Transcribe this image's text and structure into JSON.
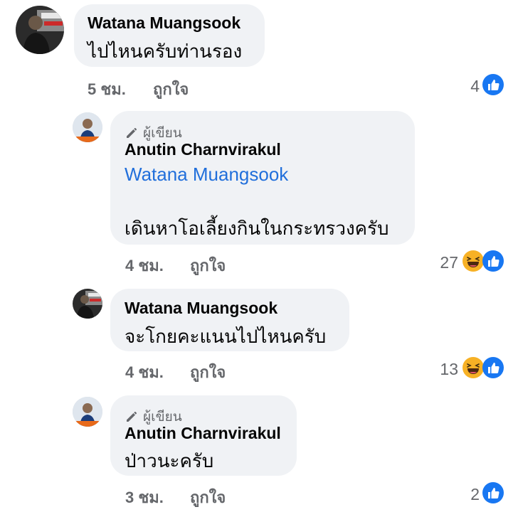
{
  "author_badge_label": "ผู้เขียน",
  "comments": [
    {
      "name": "Watana Muangsook",
      "text": "ไปไหนครับท่านรอง",
      "time": "5 ชม.",
      "like_label": "ถูกใจ",
      "reaction_count": "4",
      "reactions": [
        "like-icon"
      ]
    },
    {
      "author": true,
      "name": "Anutin Charnvirakul",
      "mention": "Watana Muangsook",
      "text": "เดินหาโอเลี้ยงกินในกระทรวงครับ",
      "time": "4 ชม.",
      "like_label": "ถูกใจ",
      "reaction_count": "27",
      "reactions": [
        "haha-icon",
        "like-icon"
      ]
    },
    {
      "name": "Watana Muangsook",
      "text": "จะโกยคะแนนไปไหนครับ",
      "time": "4 ชม.",
      "like_label": "ถูกใจ",
      "reaction_count": "13",
      "reactions": [
        "haha-icon",
        "like-icon"
      ]
    },
    {
      "author": true,
      "name": "Anutin Charnvirakul",
      "text": "ป่าวนะครับ",
      "time": "3 ชม.",
      "like_label": "ถูกใจ",
      "reaction_count": "2",
      "reactions": [
        "like-icon"
      ]
    }
  ],
  "colors": {
    "bubble": "#f0f2f5",
    "mention": "#216fdb",
    "like_blue": "#1877f2",
    "haha_yellow": "#f7b125",
    "meta_gray": "#65676b"
  }
}
